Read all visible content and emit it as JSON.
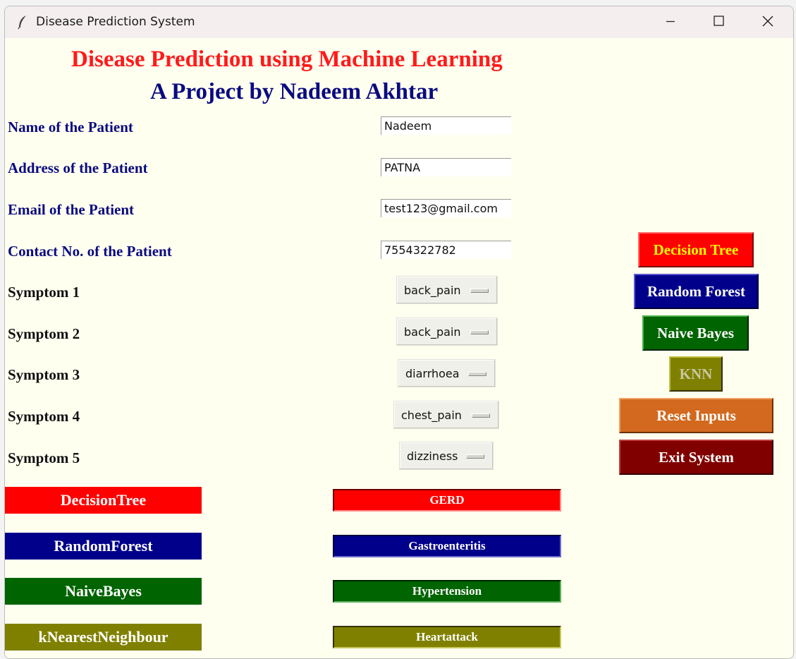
{
  "window": {
    "title": "Disease Prediction System"
  },
  "header": {
    "title": "Disease Prediction using Machine Learning",
    "subtitle": "A Project by Nadeem Akhtar"
  },
  "form": {
    "name_label": "Name of the Patient",
    "name_value": "Nadeem",
    "address_label": "Address of the Patient",
    "address_value": "PATNA",
    "email_label": "Email of the Patient",
    "email_value": "test123@gmail.com",
    "contact_label": "Contact No. of the Patient",
    "contact_value": "7554322782",
    "symptoms": [
      {
        "label": "Symptom 1",
        "value": "back_pain"
      },
      {
        "label": "Symptom 2",
        "value": "back_pain"
      },
      {
        "label": "Symptom 3",
        "value": "diarrhoea"
      },
      {
        "label": "Symptom 4",
        "value": "chest_pain"
      },
      {
        "label": "Symptom 5",
        "value": "dizziness"
      }
    ]
  },
  "buttons": {
    "decision_tree": "Decision Tree",
    "random_forest": "Random Forest",
    "naive_bayes": "Naive Bayes",
    "knn": "KNN",
    "reset": "Reset Inputs",
    "exit": "Exit System"
  },
  "results": [
    {
      "label": "DecisionTree",
      "value": "GERD",
      "color": "#ff0000"
    },
    {
      "label": "RandomForest",
      "value": "Gastroenteritis",
      "color": "#00008b"
    },
    {
      "label": "NaiveBayes",
      "value": "Hypertension",
      "color": "#006400"
    },
    {
      "label": "kNearestNeighbour",
      "value": "Heartattack",
      "color": "#808000"
    }
  ],
  "colors": {
    "background": "#fffff0",
    "title_red": "#ff1a1a",
    "title_blue": "#0a0a80",
    "decision_tree_btn": "#ff0000",
    "decision_tree_text": "#ffff00",
    "random_forest_btn": "#00008b",
    "naive_bayes_btn": "#006400",
    "knn_btn": "#808000",
    "knn_text": "#c8c8a0",
    "reset_btn": "#d2691e",
    "exit_btn": "#800000"
  },
  "icons": {
    "app": "feather-icon",
    "minimize": "minimize-icon",
    "maximize": "maximize-icon",
    "close": "close-icon"
  }
}
